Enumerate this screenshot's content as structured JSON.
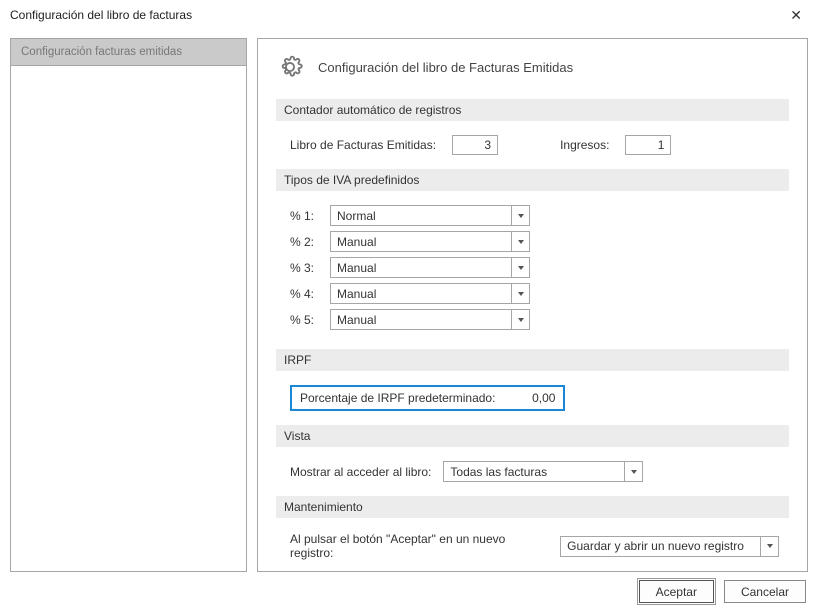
{
  "window": {
    "title": "Configuración del libro de facturas"
  },
  "nav": {
    "item": "Configuración facturas emitidas"
  },
  "header": {
    "title": "Configuración del libro de Facturas Emitidas"
  },
  "sections": {
    "counter": {
      "title": "Contador automático de registros",
      "label_libro": "Libro de Facturas Emitidas:",
      "value_libro": "3",
      "label_ingresos": "Ingresos:",
      "value_ingresos": "1"
    },
    "iva": {
      "title": "Tipos de IVA predefinidos",
      "rows": [
        {
          "label": "% 1:",
          "value": "Normal"
        },
        {
          "label": "% 2:",
          "value": "Manual"
        },
        {
          "label": "% 3:",
          "value": "Manual"
        },
        {
          "label": "% 4:",
          "value": "Manual"
        },
        {
          "label": "% 5:",
          "value": "Manual"
        }
      ]
    },
    "irpf": {
      "title": "IRPF",
      "label": "Porcentaje de IRPF predeterminado:",
      "value": "0,00"
    },
    "vista": {
      "title": "Vista",
      "label": "Mostrar al acceder al libro:",
      "value": "Todas las facturas"
    },
    "mant": {
      "title": "Mantenimiento",
      "label": "Al pulsar el botón \"Aceptar\" en un nuevo registro:",
      "value": "Guardar y abrir un nuevo registro"
    }
  },
  "footer": {
    "accept": "Aceptar",
    "cancel": "Cancelar"
  }
}
